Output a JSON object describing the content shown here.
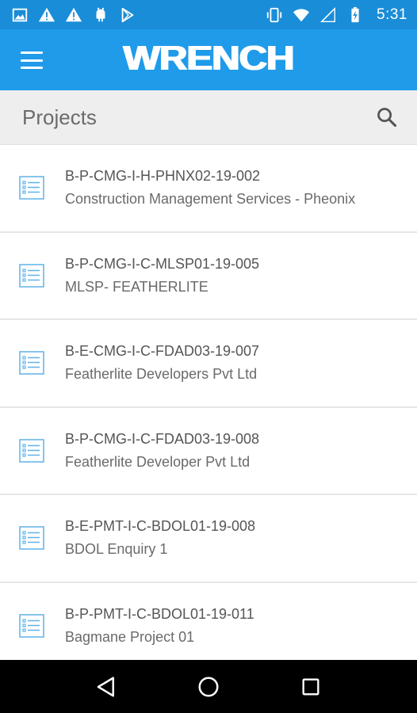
{
  "status_bar": {
    "time": "5:31",
    "left_icons": [
      "image-icon",
      "alert-icon",
      "alert-icon",
      "android-icon",
      "play-store-icon"
    ],
    "right_icons": [
      "vibrate-icon",
      "wifi-icon",
      "signal-icon",
      "battery-charging-icon"
    ]
  },
  "app_bar": {
    "brand": "WRENCH",
    "color": "#1f9bea"
  },
  "header": {
    "title": "Projects"
  },
  "projects": [
    {
      "code": "B-P-CMG-I-H-PHNX02-19-002",
      "name": "Construction Management Services - Pheonix"
    },
    {
      "code": "B-P-CMG-I-C-MLSP01-19-005",
      "name": "MLSP- FEATHERLITE"
    },
    {
      "code": "B-E-CMG-I-C-FDAD03-19-007",
      "name": "Featherlite Developers Pvt Ltd"
    },
    {
      "code": "B-P-CMG-I-C-FDAD03-19-008",
      "name": "Featherlite Developer Pvt Ltd"
    },
    {
      "code": "B-E-PMT-I-C-BDOL01-19-008",
      "name": "BDOL Enquiry 1"
    },
    {
      "code": "B-P-PMT-I-C-BDOL01-19-011",
      "name": "Bagmane Project 01"
    }
  ],
  "nav_bar": {
    "buttons": [
      "back-icon",
      "home-icon",
      "recents-icon"
    ]
  }
}
